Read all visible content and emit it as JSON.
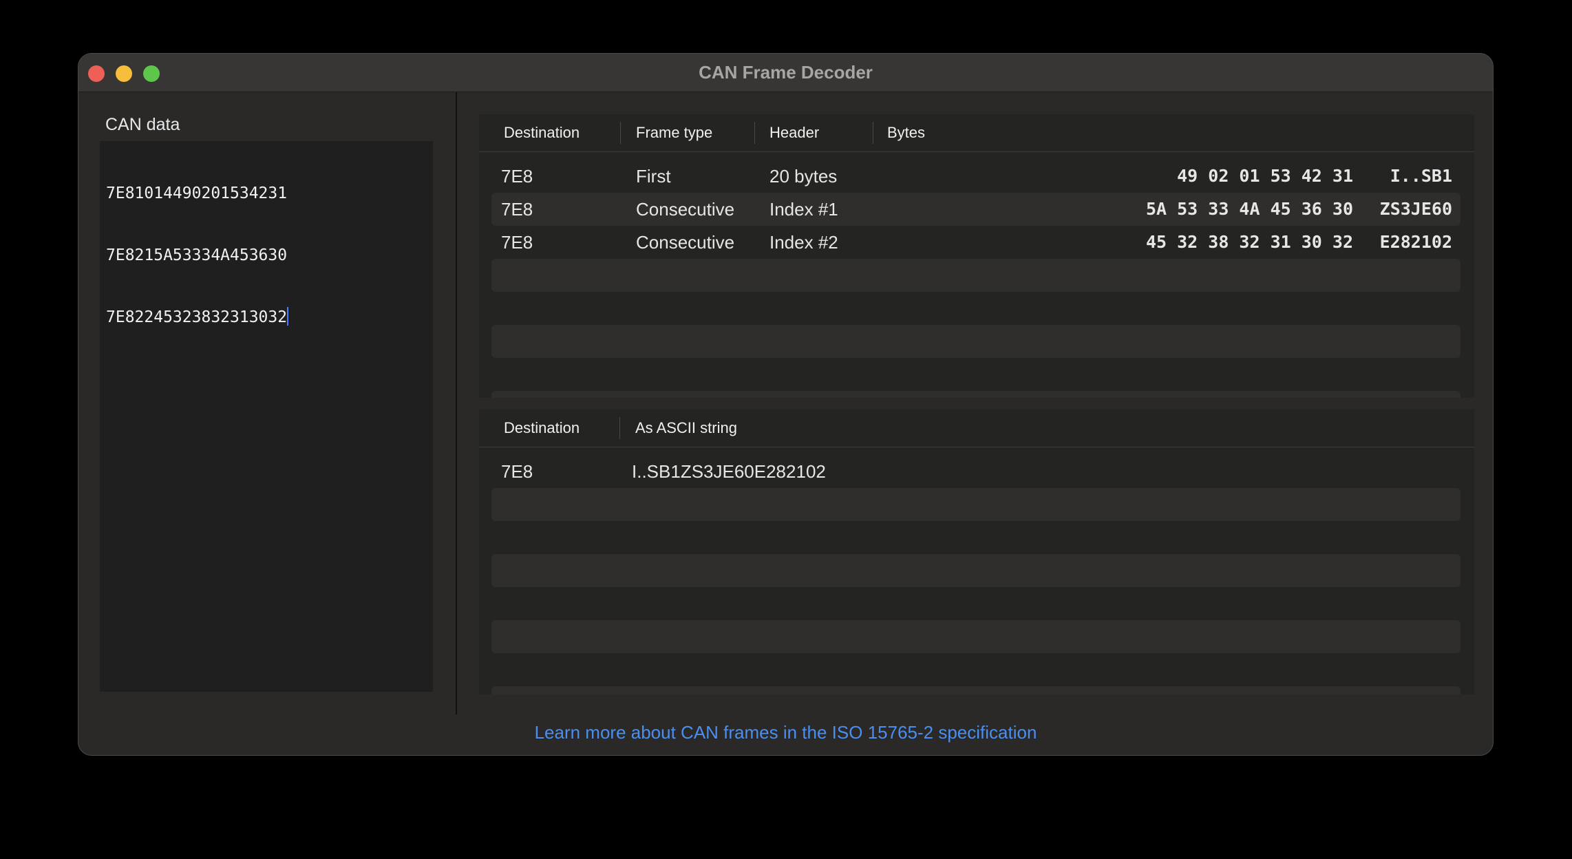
{
  "window": {
    "title": "CAN Frame Decoder"
  },
  "left": {
    "label": "CAN data",
    "lines": [
      "7E81014490201534231",
      "7E8215A53334A453630",
      "7E82245323832313032"
    ]
  },
  "frames_table": {
    "columns": [
      "Destination",
      "Frame type",
      "Header",
      "Bytes"
    ],
    "rows": [
      {
        "destination": "7E8",
        "frame_type": "First",
        "header": "20 bytes",
        "bytes": "49 02 01 53 42 31",
        "ascii": "I..SB1"
      },
      {
        "destination": "7E8",
        "frame_type": "Consecutive",
        "header": "Index #1",
        "bytes": "5A 53 33 4A 45 36 30",
        "ascii": "ZS3JE60"
      },
      {
        "destination": "7E8",
        "frame_type": "Consecutive",
        "header": "Index #2",
        "bytes": "45 32 38 32 31 30 32",
        "ascii": "E282102"
      }
    ]
  },
  "ascii_table": {
    "columns": [
      "Destination",
      "As ASCII string"
    ],
    "rows": [
      {
        "destination": "7E8",
        "ascii_string": "I..SB1ZS3JE60E282102"
      }
    ]
  },
  "footer": {
    "link_text": "Learn more about CAN frames in the ISO 15765-2 specification"
  },
  "colors": {
    "accent_link": "#4a8ff0",
    "cursor": "#4c7dff",
    "window_bg": "#2a2928"
  }
}
